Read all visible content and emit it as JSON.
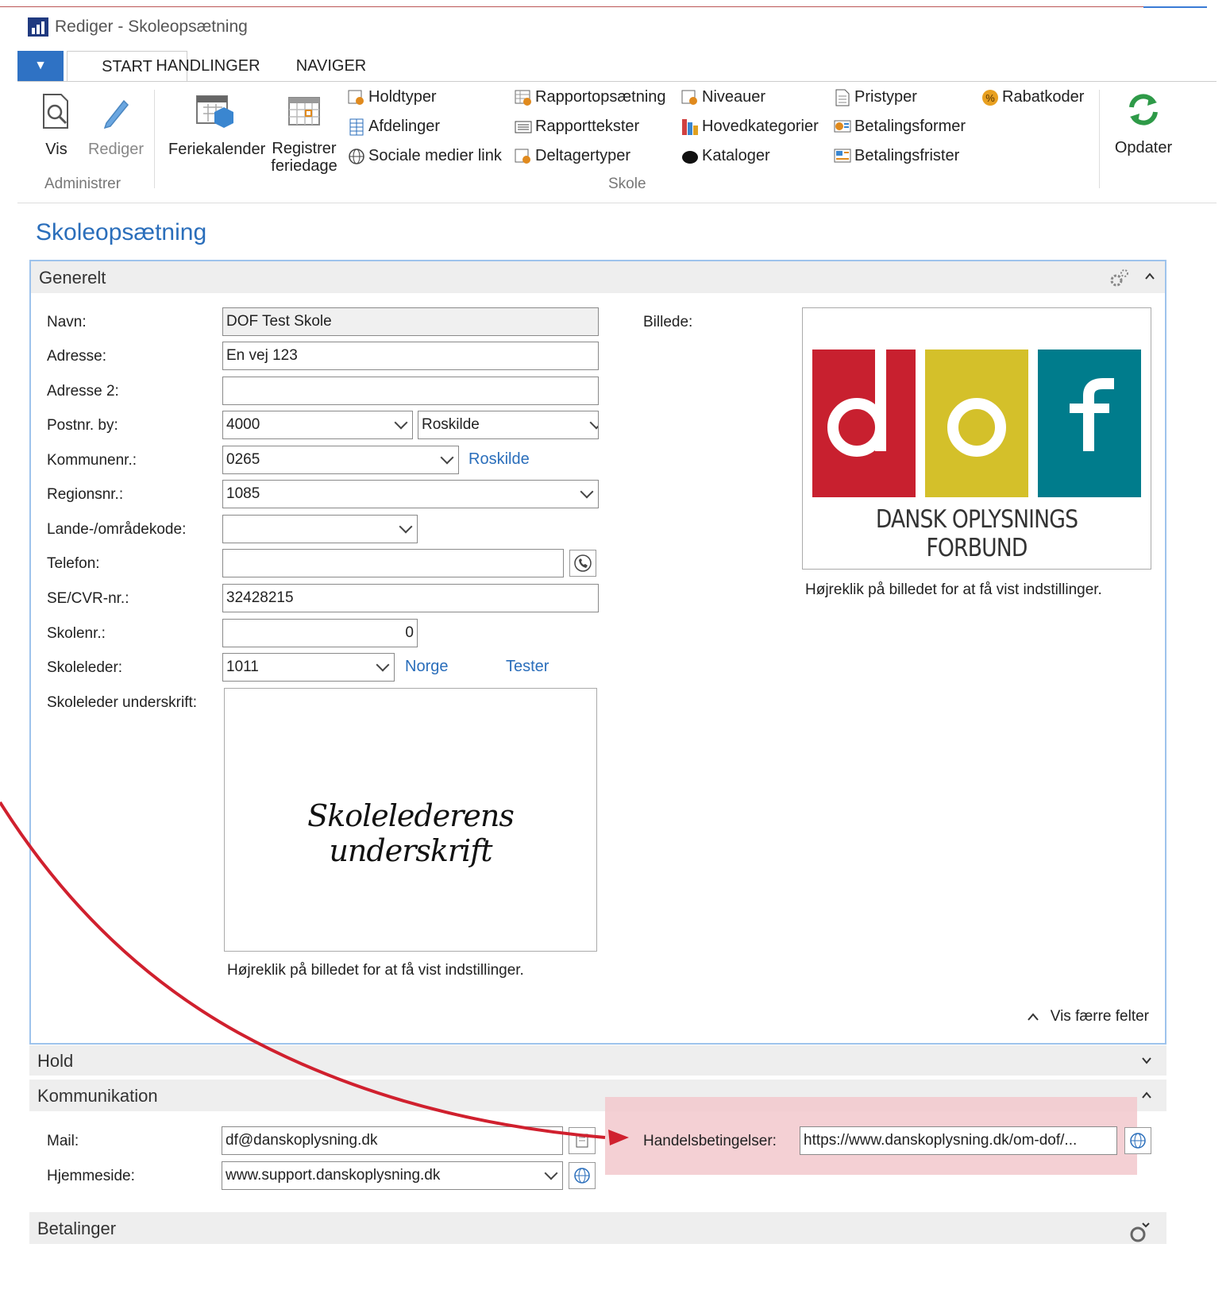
{
  "window": {
    "title": "Rediger - Skoleopsætning"
  },
  "tabs": [
    "START",
    "HANDLINGER",
    "NAVIGER"
  ],
  "ribbon": {
    "vis": "Vis",
    "rediger": "Rediger",
    "administrer": "Administrer",
    "feriekalender": "Feriekalender",
    "registrer_line1": "Registrer",
    "registrer_line2": "feriedage",
    "holdtyper": "Holdtyper",
    "afdelinger": "Afdelinger",
    "sociale": "Sociale medier link",
    "rapportopsaetning": "Rapportopsætning",
    "rapporttekster": "Rapporttekster",
    "deltagertyper": "Deltagertyper",
    "niveauer": "Niveauer",
    "hovedkategorier": "Hovedkategorier",
    "kataloger": "Kataloger",
    "pristyper": "Pristyper",
    "betalingsformer": "Betalingsformer",
    "betalingsfrister": "Betalingsfrister",
    "rabatkoder": "Rabatkoder",
    "skole": "Skole",
    "opdater": "Opdater"
  },
  "page_title": "Skoleopsætning",
  "generelt": {
    "title": "Generelt",
    "navn_label": "Navn:",
    "navn": "DOF Test Skole",
    "adresse_label": "Adresse:",
    "adresse": "En vej 123",
    "adresse2_label": "Adresse 2:",
    "adresse2": "",
    "postnr_label": "Postnr. by:",
    "postnr": "4000",
    "by": "Roskilde",
    "kommune_label": "Kommunenr.:",
    "kommune": "0265",
    "kommune_link": "Roskilde",
    "region_label": "Regionsnr.:",
    "region": "1085",
    "lande_label": "Lande-/områdekode:",
    "lande": "",
    "telefon_label": "Telefon:",
    "telefon": "",
    "cvr_label": "SE/CVR-nr.:",
    "cvr": "32428215",
    "skolenr_label": "Skolenr.:",
    "skolenr": "0",
    "skoleleder_label": "Skoleleder:",
    "skoleleder": "1011",
    "skoleleder_link1": "Norge",
    "skoleleder_link2": "Tester",
    "underskrift_label": "Skoleleder underskrift:",
    "underskrift_text": "Skolelederens underskrift",
    "underskrift_hint": "Højreklik på billedet for at få vist indstillinger.",
    "billede_label": "Billede:",
    "logo_text": "DANSK OPLYSNINGS FORBUND",
    "billede_hint": "Højreklik på billedet for at få vist indstillinger.",
    "vis_faerre": "Vis færre felter"
  },
  "hold": {
    "title": "Hold"
  },
  "kommunikation": {
    "title": "Kommunikation",
    "mail_label": "Mail:",
    "mail": "df@danskoplysning.dk",
    "hjemmeside_label": "Hjemmeside:",
    "hjemmeside": "www.support.danskoplysning.dk",
    "handels_label": "Handelsbetingelser:",
    "handels": "https://www.danskoplysning.dk/om-dof/..."
  },
  "betalinger": {
    "title": "Betalinger"
  },
  "colors": {
    "accent": "#2a6ebb",
    "highlight": "#f2c8cc",
    "arrow": "#d0202e",
    "logo_red": "#c8202f",
    "logo_yellow": "#d4c02a",
    "logo_teal": "#007c8c"
  }
}
